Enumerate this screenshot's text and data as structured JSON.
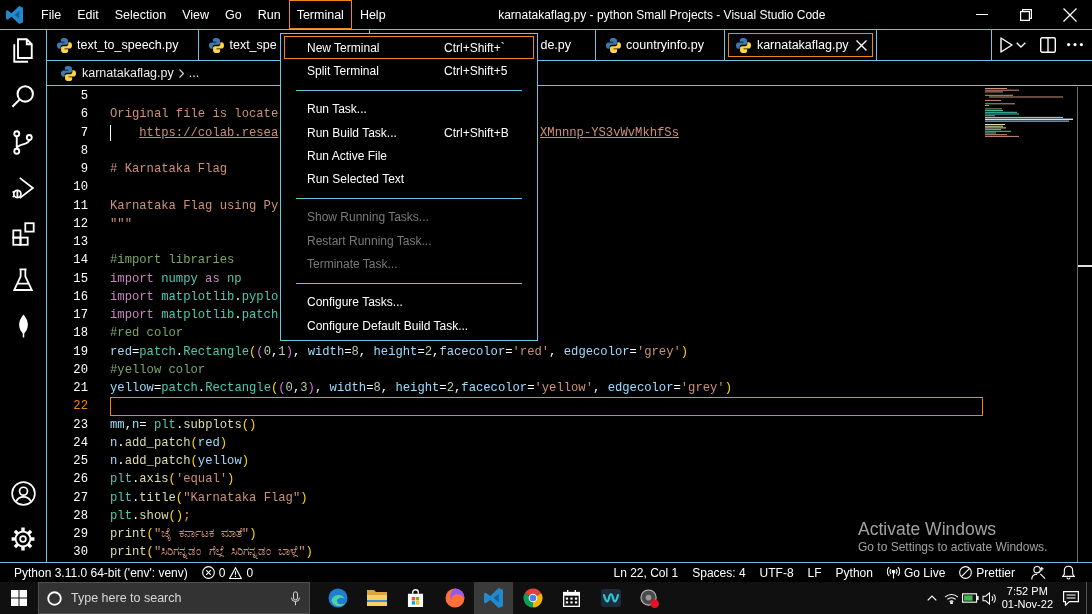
{
  "window": {
    "title": "karnatakaflag.py - python Small Projects - Visual Studio Code"
  },
  "menubar": {
    "items": [
      {
        "label": "File",
        "selected": false
      },
      {
        "label": "Edit",
        "selected": false
      },
      {
        "label": "Selection",
        "selected": false
      },
      {
        "label": "View",
        "selected": false
      },
      {
        "label": "Go",
        "selected": false
      },
      {
        "label": "Run",
        "selected": false
      },
      {
        "label": "Terminal",
        "selected": true
      },
      {
        "label": "Help",
        "selected": false
      }
    ]
  },
  "terminal_menu": {
    "items": [
      {
        "kind": "item",
        "label": "New Terminal",
        "shortcut": "Ctrl+Shift+`",
        "selected": true,
        "disabled": false
      },
      {
        "kind": "item",
        "label": "Split Terminal",
        "shortcut": "Ctrl+Shift+5",
        "selected": false,
        "disabled": false
      },
      {
        "kind": "separator"
      },
      {
        "kind": "item",
        "label": "Run Task...",
        "selected": false,
        "disabled": false
      },
      {
        "kind": "item",
        "label": "Run Build Task...",
        "shortcut": "Ctrl+Shift+B",
        "selected": false,
        "disabled": false
      },
      {
        "kind": "item",
        "label": "Run Active File",
        "selected": false,
        "disabled": false
      },
      {
        "kind": "item",
        "label": "Run Selected Text",
        "selected": false,
        "disabled": false
      },
      {
        "kind": "separator"
      },
      {
        "kind": "item",
        "label": "Show Running Tasks...",
        "selected": false,
        "disabled": true
      },
      {
        "kind": "item",
        "label": "Restart Running Task...",
        "selected": false,
        "disabled": true
      },
      {
        "kind": "item",
        "label": "Terminate Task...",
        "selected": false,
        "disabled": true
      },
      {
        "kind": "separator"
      },
      {
        "kind": "item",
        "label": "Configure Tasks...",
        "selected": false,
        "disabled": false
      },
      {
        "kind": "item",
        "label": "Configure Default Build Task...",
        "selected": false,
        "disabled": false
      }
    ]
  },
  "activity_bar": {
    "top": [
      {
        "kind": "explorer"
      },
      {
        "kind": "search"
      },
      {
        "kind": "scm"
      },
      {
        "kind": "debug"
      },
      {
        "kind": "extensions"
      },
      {
        "kind": "testing"
      },
      {
        "kind": "leaf"
      }
    ],
    "bottom": [
      {
        "kind": "account"
      },
      {
        "kind": "settings"
      }
    ]
  },
  "tabs": [
    {
      "kind": "full",
      "label": "text_to_speech.py",
      "selected": false
    },
    {
      "kind": "head",
      "label": "text_spe",
      "selected": false
    },
    {
      "kind": "tail",
      "label": "de.py",
      "selected": false
    },
    {
      "kind": "full",
      "label": "countryinfo.py",
      "selected": false
    },
    {
      "kind": "full",
      "label": "karnatakaflag.py",
      "selected": true
    }
  ],
  "breadcrumb": [
    "karnatakaflag.py",
    "..."
  ],
  "editor": {
    "lines": [
      {
        "number": "5",
        "current": false,
        "indented": false
      },
      {
        "number": "6",
        "current": false,
        "indented": false,
        "tokens": [
          {
            "kind": "string",
            "text": "Original file is locate"
          }
        ]
      },
      {
        "number": "7",
        "current": false,
        "indented": true,
        "tokens": [
          {
            "kind": "link",
            "text": "https://colab.resea"
          }
        ],
        "after_menu": [
          {
            "kind": "link",
            "text": "XMnnnp-YS3vWvMkhfSs"
          }
        ]
      },
      {
        "number": "8",
        "current": false,
        "indented": false
      },
      {
        "number": "9",
        "current": false,
        "indented": false,
        "tokens": [
          {
            "kind": "string",
            "text": "# Karnataka Flag"
          }
        ]
      },
      {
        "number": "10",
        "current": false,
        "indented": false
      },
      {
        "number": "11",
        "current": false,
        "indented": false,
        "tokens": [
          {
            "kind": "string",
            "text": "Karnataka Flag using Py"
          }
        ]
      },
      {
        "number": "12",
        "current": false,
        "indented": false,
        "tokens": [
          {
            "kind": "string",
            "text": "\"\"\""
          }
        ]
      },
      {
        "number": "13",
        "current": false,
        "indented": false
      },
      {
        "number": "14",
        "current": false,
        "indented": false,
        "tokens": [
          {
            "kind": "comment",
            "text": "#import libraries"
          }
        ]
      },
      {
        "number": "15",
        "current": false,
        "indented": false,
        "tokens": [
          {
            "kind": "keyword",
            "text": "import"
          },
          {
            "kind": "type",
            "text": " numpy"
          },
          {
            "kind": "keyword",
            "text": " as"
          },
          {
            "kind": "type",
            "text": " np"
          }
        ]
      },
      {
        "number": "16",
        "current": false,
        "indented": false,
        "tokens": [
          {
            "kind": "keyword",
            "text": "import"
          },
          {
            "kind": "type",
            "text": " matplotlib"
          },
          {
            "kind": "plain",
            "text": "."
          },
          {
            "kind": "type",
            "text": "pyplo"
          }
        ]
      },
      {
        "number": "17",
        "current": false,
        "indented": false,
        "tokens": [
          {
            "kind": "keyword",
            "text": "import"
          },
          {
            "kind": "type",
            "text": " matplotlib"
          },
          {
            "kind": "plain",
            "text": "."
          },
          {
            "kind": "type",
            "text": "patch"
          }
        ]
      },
      {
        "number": "18",
        "current": false,
        "indented": false,
        "tokens": [
          {
            "kind": "comment",
            "text": "#red color"
          }
        ]
      },
      {
        "number": "19",
        "current": false,
        "indented": false,
        "tokens": [
          {
            "kind": "var",
            "text": "red"
          },
          {
            "kind": "plain",
            "text": "="
          },
          {
            "kind": "type",
            "text": "patch"
          },
          {
            "kind": "plain",
            "text": "."
          },
          {
            "kind": "type",
            "text": "Rectangle"
          },
          {
            "kind": "bracket",
            "text": "("
          },
          {
            "kind": "bracket2",
            "text": "("
          },
          {
            "kind": "num",
            "text": "0"
          },
          {
            "kind": "plain",
            "text": ","
          },
          {
            "kind": "num",
            "text": "1"
          },
          {
            "kind": "bracket2",
            "text": ")"
          },
          {
            "kind": "plain",
            "text": ", "
          },
          {
            "kind": "var",
            "text": "width"
          },
          {
            "kind": "plain",
            "text": "="
          },
          {
            "kind": "num",
            "text": "8"
          },
          {
            "kind": "plain",
            "text": ", "
          },
          {
            "kind": "var",
            "text": "height"
          },
          {
            "kind": "plain",
            "text": "="
          },
          {
            "kind": "num",
            "text": "2"
          },
          {
            "kind": "plain",
            "text": ","
          },
          {
            "kind": "var",
            "text": "facecolor"
          },
          {
            "kind": "plain",
            "text": "="
          },
          {
            "kind": "string",
            "text": "'red'"
          },
          {
            "kind": "plain",
            "text": ", "
          },
          {
            "kind": "var",
            "text": "edgecolor"
          },
          {
            "kind": "plain",
            "text": "="
          },
          {
            "kind": "string",
            "text": "'grey'"
          },
          {
            "kind": "bracket",
            "text": ")"
          }
        ]
      },
      {
        "number": "20",
        "current": false,
        "indented": false,
        "tokens": [
          {
            "kind": "comment",
            "text": "#yellow color"
          }
        ]
      },
      {
        "number": "21",
        "current": false,
        "indented": false,
        "tokens": [
          {
            "kind": "var",
            "text": "yellow"
          },
          {
            "kind": "plain",
            "text": "="
          },
          {
            "kind": "type",
            "text": "patch"
          },
          {
            "kind": "plain",
            "text": "."
          },
          {
            "kind": "type",
            "text": "Rectangle"
          },
          {
            "kind": "bracket",
            "text": "("
          },
          {
            "kind": "bracket2",
            "text": "("
          },
          {
            "kind": "num",
            "text": "0"
          },
          {
            "kind": "plain",
            "text": ","
          },
          {
            "kind": "num",
            "text": "3"
          },
          {
            "kind": "bracket2",
            "text": ")"
          },
          {
            "kind": "plain",
            "text": ", "
          },
          {
            "kind": "var",
            "text": "width"
          },
          {
            "kind": "plain",
            "text": "="
          },
          {
            "kind": "num",
            "text": "8"
          },
          {
            "kind": "plain",
            "text": ", "
          },
          {
            "kind": "var",
            "text": "height"
          },
          {
            "kind": "plain",
            "text": "="
          },
          {
            "kind": "num",
            "text": "2"
          },
          {
            "kind": "plain",
            "text": ","
          },
          {
            "kind": "var",
            "text": "facecolor"
          },
          {
            "kind": "plain",
            "text": "="
          },
          {
            "kind": "string",
            "text": "'yellow'"
          },
          {
            "kind": "plain",
            "text": ", "
          },
          {
            "kind": "var",
            "text": "edgecolor"
          },
          {
            "kind": "plain",
            "text": "="
          },
          {
            "kind": "string",
            "text": "'grey'"
          },
          {
            "kind": "bracket",
            "text": ")"
          }
        ]
      },
      {
        "number": "22",
        "current": true,
        "indented": false
      },
      {
        "number": "23",
        "current": false,
        "indented": false,
        "tokens": [
          {
            "kind": "var",
            "text": "mm"
          },
          {
            "kind": "plain",
            "text": ","
          },
          {
            "kind": "var",
            "text": "n"
          },
          {
            "kind": "plain",
            "text": "= "
          },
          {
            "kind": "type",
            "text": "plt"
          },
          {
            "kind": "plain",
            "text": "."
          },
          {
            "kind": "func",
            "text": "subplots"
          },
          {
            "kind": "bracket",
            "text": "()"
          }
        ]
      },
      {
        "number": "24",
        "current": false,
        "indented": false,
        "tokens": [
          {
            "kind": "var",
            "text": "n"
          },
          {
            "kind": "plain",
            "text": "."
          },
          {
            "kind": "func",
            "text": "add_patch"
          },
          {
            "kind": "bracket",
            "text": "("
          },
          {
            "kind": "var",
            "text": "red"
          },
          {
            "kind": "bracket",
            "text": ")"
          }
        ]
      },
      {
        "number": "25",
        "current": false,
        "indented": false,
        "tokens": [
          {
            "kind": "var",
            "text": "n"
          },
          {
            "kind": "plain",
            "text": "."
          },
          {
            "kind": "func",
            "text": "add_patch"
          },
          {
            "kind": "bracket",
            "text": "("
          },
          {
            "kind": "var",
            "text": "yellow"
          },
          {
            "kind": "bracket",
            "text": ")"
          }
        ]
      },
      {
        "number": "26",
        "current": false,
        "indented": false,
        "tokens": [
          {
            "kind": "type",
            "text": "plt"
          },
          {
            "kind": "plain",
            "text": "."
          },
          {
            "kind": "func",
            "text": "axis"
          },
          {
            "kind": "bracket",
            "text": "("
          },
          {
            "kind": "string",
            "text": "'equal'"
          },
          {
            "kind": "bracket",
            "text": ")"
          }
        ]
      },
      {
        "number": "27",
        "current": false,
        "indented": false,
        "tokens": [
          {
            "kind": "type",
            "text": "plt"
          },
          {
            "kind": "plain",
            "text": "."
          },
          {
            "kind": "func",
            "text": "title"
          },
          {
            "kind": "bracket",
            "text": "("
          },
          {
            "kind": "string",
            "text": "\"Karnataka Flag\""
          },
          {
            "kind": "bracket",
            "text": ")"
          }
        ]
      },
      {
        "number": "28",
        "current": false,
        "indented": false,
        "tokens": [
          {
            "kind": "type",
            "text": "plt"
          },
          {
            "kind": "plain",
            "text": "."
          },
          {
            "kind": "func",
            "text": "show"
          },
          {
            "kind": "bracket",
            "text": "()"
          },
          {
            "kind": "error",
            "text": ";"
          }
        ]
      },
      {
        "number": "29",
        "current": false,
        "indented": false,
        "tokens": [
          {
            "kind": "func",
            "text": "print"
          },
          {
            "kind": "bracket",
            "text": "("
          },
          {
            "kind": "string",
            "text": "\"ಜೈ ಕರ್ನಾಟಕ ಮಾತೆ\""
          },
          {
            "kind": "bracket",
            "text": ")"
          }
        ]
      },
      {
        "number": "30",
        "current": false,
        "indented": false,
        "tokens": [
          {
            "kind": "func",
            "text": "print"
          },
          {
            "kind": "bracket",
            "text": "("
          },
          {
            "kind": "string",
            "text": "\"ಸಿರಿಗನ್ನಡಂ ಗೆಲ್ಗೆ ಸಿರಿಗನ್ನಡಂ ಬಾಳ್ಗೆ\""
          },
          {
            "kind": "bracket",
            "text": ")"
          }
        ]
      }
    ]
  },
  "activation_notice": {
    "title": "Activate Windows",
    "message": "Go to Settings to activate Windows."
  },
  "status_bar": {
    "left": [
      {
        "kind": "text",
        "text": "Python 3.11.0 64-bit ('env': venv)"
      },
      {
        "kind": "problems",
        "errors": "0",
        "warnings": "0"
      }
    ],
    "right": [
      {
        "kind": "text",
        "text": "Ln 22, Col 1"
      },
      {
        "kind": "text",
        "text": "Spaces: 4"
      },
      {
        "kind": "text",
        "text": "UTF-8"
      },
      {
        "kind": "text",
        "text": "LF"
      },
      {
        "kind": "text",
        "text": "Python"
      },
      {
        "kind": "live",
        "text": "Go Live"
      },
      {
        "kind": "formatter",
        "text": "Prettier"
      },
      {
        "kind": "feedback"
      },
      {
        "kind": "bell"
      }
    ]
  },
  "taskbar": {
    "search": {
      "placeholder": "Type here to search"
    },
    "apps": [
      {
        "kind": "edge",
        "active": false
      },
      {
        "kind": "explorer",
        "active": false
      },
      {
        "kind": "store",
        "active": false
      },
      {
        "kind": "firefox",
        "active": false
      },
      {
        "kind": "vscode",
        "active": true
      },
      {
        "kind": "chrome",
        "active": false
      },
      {
        "kind": "calendar",
        "active": false
      },
      {
        "kind": "stream",
        "active": false
      },
      {
        "kind": "recorder",
        "active": false
      }
    ],
    "clock": {
      "time": "7:52 PM",
      "date": "01-Nov-22"
    }
  }
}
